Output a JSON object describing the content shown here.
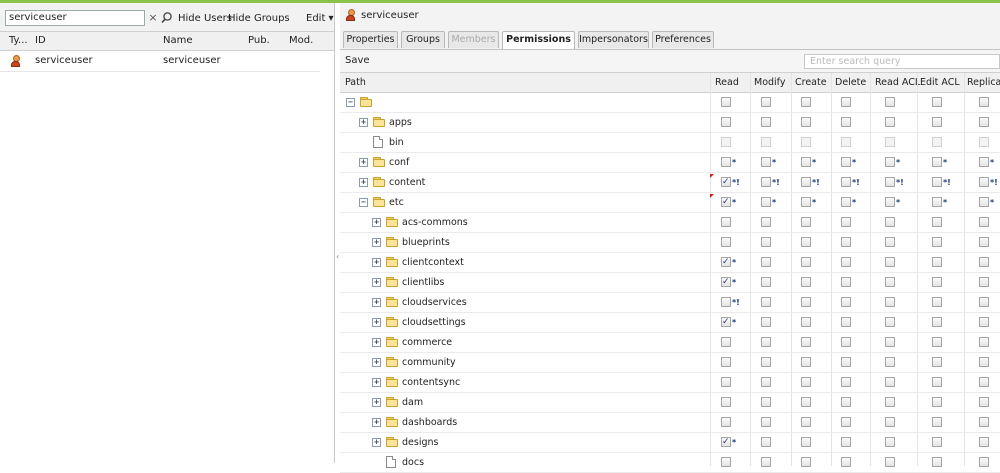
{
  "left_pane": {
    "search_value": "serviceuser",
    "clear_glyph": "×",
    "search_icon": "magnifier-icon",
    "hide_users_label": "Hide Users",
    "hide_groups_label": "Hide Groups",
    "edit_label": "Edit ▾",
    "columns": [
      "Ty...",
      "ID",
      "Name",
      "Pub.",
      "Mod."
    ],
    "rows": [
      {
        "type_icon": "user-icon",
        "id": "serviceuser",
        "name": "serviceuser",
        "pub": "",
        "mod": ""
      }
    ]
  },
  "right_pane": {
    "title": "serviceuser",
    "tabs": [
      {
        "label": "Properties",
        "state": "normal"
      },
      {
        "label": "Groups",
        "state": "normal"
      },
      {
        "label": "Members",
        "state": "disabled"
      },
      {
        "label": "Permissions",
        "state": "active"
      },
      {
        "label": "Impersonators",
        "state": "normal"
      },
      {
        "label": "Preferences",
        "state": "normal"
      }
    ],
    "save_label": "Save",
    "search_placeholder": "Enter search query",
    "columns": [
      "Path",
      "Read",
      "Modify",
      "Create",
      "Delete",
      "Read ACL",
      "Edit ACL",
      "Replicate"
    ],
    "rows": [
      {
        "level": 0,
        "expander": "minus",
        "icon": "folder",
        "name": "",
        "disabled": false,
        "flag": false,
        "perms": [
          {
            "c": false,
            "m": ""
          },
          {
            "c": false,
            "m": ""
          },
          {
            "c": false,
            "m": ""
          },
          {
            "c": false,
            "m": ""
          },
          {
            "c": false,
            "m": ""
          },
          {
            "c": false,
            "m": ""
          },
          {
            "c": false,
            "m": ""
          }
        ]
      },
      {
        "level": 1,
        "expander": "plus",
        "icon": "folder",
        "name": "apps",
        "disabled": false,
        "flag": false,
        "perms": [
          {
            "c": false,
            "m": ""
          },
          {
            "c": false,
            "m": ""
          },
          {
            "c": false,
            "m": ""
          },
          {
            "c": false,
            "m": ""
          },
          {
            "c": false,
            "m": ""
          },
          {
            "c": false,
            "m": ""
          },
          {
            "c": false,
            "m": ""
          }
        ]
      },
      {
        "level": 1,
        "expander": "",
        "icon": "file",
        "name": "bin",
        "disabled": true,
        "flag": false,
        "perms": [
          {
            "c": false,
            "m": ""
          },
          {
            "c": false,
            "m": ""
          },
          {
            "c": false,
            "m": ""
          },
          {
            "c": false,
            "m": ""
          },
          {
            "c": false,
            "m": ""
          },
          {
            "c": false,
            "m": ""
          },
          {
            "c": false,
            "m": ""
          }
        ]
      },
      {
        "level": 1,
        "expander": "plus",
        "icon": "folder",
        "name": "conf",
        "disabled": false,
        "flag": false,
        "perms": [
          {
            "c": false,
            "m": "*"
          },
          {
            "c": false,
            "m": "*"
          },
          {
            "c": false,
            "m": "*"
          },
          {
            "c": false,
            "m": "*"
          },
          {
            "c": false,
            "m": "*"
          },
          {
            "c": false,
            "m": "*"
          },
          {
            "c": false,
            "m": "*"
          }
        ]
      },
      {
        "level": 1,
        "expander": "plus",
        "icon": "folder",
        "name": "content",
        "disabled": false,
        "flag": true,
        "perms": [
          {
            "c": true,
            "m": "*!"
          },
          {
            "c": false,
            "m": "*!"
          },
          {
            "c": false,
            "m": "*!"
          },
          {
            "c": false,
            "m": "*!"
          },
          {
            "c": false,
            "m": "*!"
          },
          {
            "c": false,
            "m": "*!"
          },
          {
            "c": false,
            "m": "*!"
          }
        ]
      },
      {
        "level": 1,
        "expander": "minus",
        "icon": "folder",
        "name": "etc",
        "disabled": false,
        "flag": true,
        "perms": [
          {
            "c": true,
            "m": "*"
          },
          {
            "c": false,
            "m": "*"
          },
          {
            "c": false,
            "m": "*"
          },
          {
            "c": false,
            "m": "*"
          },
          {
            "c": false,
            "m": "*"
          },
          {
            "c": false,
            "m": "*"
          },
          {
            "c": false,
            "m": "*"
          }
        ]
      },
      {
        "level": 2,
        "expander": "plus",
        "icon": "folder",
        "name": "acs-commons",
        "disabled": false,
        "flag": false,
        "perms": [
          {
            "c": false,
            "m": ""
          },
          {
            "c": false,
            "m": ""
          },
          {
            "c": false,
            "m": ""
          },
          {
            "c": false,
            "m": ""
          },
          {
            "c": false,
            "m": ""
          },
          {
            "c": false,
            "m": ""
          },
          {
            "c": false,
            "m": ""
          }
        ]
      },
      {
        "level": 2,
        "expander": "plus",
        "icon": "folder",
        "name": "blueprints",
        "disabled": false,
        "flag": false,
        "perms": [
          {
            "c": false,
            "m": ""
          },
          {
            "c": false,
            "m": ""
          },
          {
            "c": false,
            "m": ""
          },
          {
            "c": false,
            "m": ""
          },
          {
            "c": false,
            "m": ""
          },
          {
            "c": false,
            "m": ""
          },
          {
            "c": false,
            "m": ""
          }
        ]
      },
      {
        "level": 2,
        "expander": "plus",
        "icon": "folder",
        "name": "clientcontext",
        "disabled": false,
        "flag": false,
        "perms": [
          {
            "c": true,
            "m": "*"
          },
          {
            "c": false,
            "m": ""
          },
          {
            "c": false,
            "m": ""
          },
          {
            "c": false,
            "m": ""
          },
          {
            "c": false,
            "m": ""
          },
          {
            "c": false,
            "m": ""
          },
          {
            "c": false,
            "m": ""
          }
        ]
      },
      {
        "level": 2,
        "expander": "plus",
        "icon": "folder",
        "name": "clientlibs",
        "disabled": false,
        "flag": false,
        "perms": [
          {
            "c": true,
            "m": "*"
          },
          {
            "c": false,
            "m": ""
          },
          {
            "c": false,
            "m": ""
          },
          {
            "c": false,
            "m": ""
          },
          {
            "c": false,
            "m": ""
          },
          {
            "c": false,
            "m": ""
          },
          {
            "c": false,
            "m": ""
          }
        ]
      },
      {
        "level": 2,
        "expander": "plus",
        "icon": "folder",
        "name": "cloudservices",
        "disabled": false,
        "flag": false,
        "perms": [
          {
            "c": false,
            "m": "*!"
          },
          {
            "c": false,
            "m": ""
          },
          {
            "c": false,
            "m": ""
          },
          {
            "c": false,
            "m": ""
          },
          {
            "c": false,
            "m": ""
          },
          {
            "c": false,
            "m": ""
          },
          {
            "c": false,
            "m": ""
          }
        ]
      },
      {
        "level": 2,
        "expander": "plus",
        "icon": "folder",
        "name": "cloudsettings",
        "disabled": false,
        "flag": false,
        "perms": [
          {
            "c": true,
            "m": "*"
          },
          {
            "c": false,
            "m": ""
          },
          {
            "c": false,
            "m": ""
          },
          {
            "c": false,
            "m": ""
          },
          {
            "c": false,
            "m": ""
          },
          {
            "c": false,
            "m": ""
          },
          {
            "c": false,
            "m": ""
          }
        ]
      },
      {
        "level": 2,
        "expander": "plus",
        "icon": "folder",
        "name": "commerce",
        "disabled": false,
        "flag": false,
        "perms": [
          {
            "c": false,
            "m": ""
          },
          {
            "c": false,
            "m": ""
          },
          {
            "c": false,
            "m": ""
          },
          {
            "c": false,
            "m": ""
          },
          {
            "c": false,
            "m": ""
          },
          {
            "c": false,
            "m": ""
          },
          {
            "c": false,
            "m": ""
          }
        ]
      },
      {
        "level": 2,
        "expander": "plus",
        "icon": "folder",
        "name": "community",
        "disabled": false,
        "flag": false,
        "perms": [
          {
            "c": false,
            "m": ""
          },
          {
            "c": false,
            "m": ""
          },
          {
            "c": false,
            "m": ""
          },
          {
            "c": false,
            "m": ""
          },
          {
            "c": false,
            "m": ""
          },
          {
            "c": false,
            "m": ""
          },
          {
            "c": false,
            "m": ""
          }
        ]
      },
      {
        "level": 2,
        "expander": "plus",
        "icon": "folder",
        "name": "contentsync",
        "disabled": false,
        "flag": false,
        "perms": [
          {
            "c": false,
            "m": ""
          },
          {
            "c": false,
            "m": ""
          },
          {
            "c": false,
            "m": ""
          },
          {
            "c": false,
            "m": ""
          },
          {
            "c": false,
            "m": ""
          },
          {
            "c": false,
            "m": ""
          },
          {
            "c": false,
            "m": ""
          }
        ]
      },
      {
        "level": 2,
        "expander": "plus",
        "icon": "folder",
        "name": "dam",
        "disabled": false,
        "flag": false,
        "perms": [
          {
            "c": false,
            "m": ""
          },
          {
            "c": false,
            "m": ""
          },
          {
            "c": false,
            "m": ""
          },
          {
            "c": false,
            "m": ""
          },
          {
            "c": false,
            "m": ""
          },
          {
            "c": false,
            "m": ""
          },
          {
            "c": false,
            "m": ""
          }
        ]
      },
      {
        "level": 2,
        "expander": "plus",
        "icon": "folder",
        "name": "dashboards",
        "disabled": false,
        "flag": false,
        "perms": [
          {
            "c": false,
            "m": ""
          },
          {
            "c": false,
            "m": ""
          },
          {
            "c": false,
            "m": ""
          },
          {
            "c": false,
            "m": ""
          },
          {
            "c": false,
            "m": ""
          },
          {
            "c": false,
            "m": ""
          },
          {
            "c": false,
            "m": ""
          }
        ]
      },
      {
        "level": 2,
        "expander": "plus",
        "icon": "folder",
        "name": "designs",
        "disabled": false,
        "flag": false,
        "perms": [
          {
            "c": true,
            "m": "*"
          },
          {
            "c": false,
            "m": ""
          },
          {
            "c": false,
            "m": ""
          },
          {
            "c": false,
            "m": ""
          },
          {
            "c": false,
            "m": ""
          },
          {
            "c": false,
            "m": ""
          },
          {
            "c": false,
            "m": ""
          }
        ]
      },
      {
        "level": 2,
        "expander": "",
        "icon": "file",
        "name": "docs",
        "disabled": false,
        "flag": false,
        "perms": [
          {
            "c": false,
            "m": ""
          },
          {
            "c": false,
            "m": ""
          },
          {
            "c": false,
            "m": ""
          },
          {
            "c": false,
            "m": ""
          },
          {
            "c": false,
            "m": ""
          },
          {
            "c": false,
            "m": ""
          },
          {
            "c": false,
            "m": ""
          }
        ]
      }
    ]
  },
  "colors": {
    "accent_bar": "#8bc34a",
    "check_blue": "#1e3f7a",
    "flag_red": "#d02020"
  }
}
